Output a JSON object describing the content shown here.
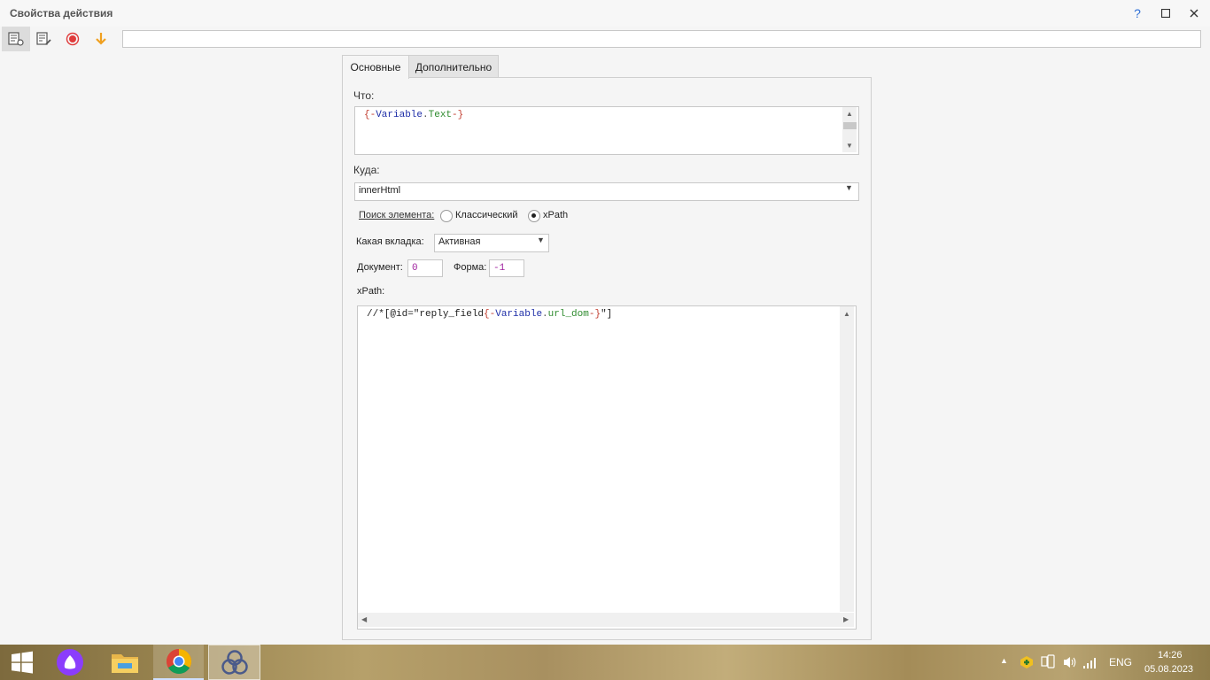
{
  "window": {
    "title": "Свойства действия"
  },
  "titlebar": {
    "help": "?",
    "maximize": "☐",
    "close": "✕"
  },
  "toolbar": {
    "icons": [
      "properties-icon",
      "edit-list-icon",
      "record-icon",
      "download-arrow-icon"
    ],
    "input_value": ""
  },
  "tabs": [
    {
      "label": "Основные",
      "active": true
    },
    {
      "label": "Дополнительно",
      "active": false
    }
  ],
  "form": {
    "what_label": "Что:",
    "what_value": {
      "open": "{-",
      "var": "Variable",
      "dot": ".",
      "name": "Text",
      "close": "-}"
    },
    "where_label": "Куда:",
    "where_value": "innerHtml",
    "search_label": "Поиск элемента:",
    "search_options": [
      "Классический",
      "xPath"
    ],
    "search_selected": "xPath",
    "which_tab_label": "Какая вкладка:",
    "which_tab_value": "Активная",
    "document_label": "Документ:",
    "document_value": "0",
    "form_label": "Форма:",
    "form_value": "-1",
    "xpath_label": "xPath:",
    "xpath_value": {
      "prefix": "//*[@id=\"reply_field",
      "open": "{-",
      "var": "Variable",
      "dot": ".",
      "name": "url_dom",
      "close": "-}",
      "suffix": "\"]"
    }
  },
  "colors": {
    "code_brace": "#c0392b",
    "code_var": "#1f2fa8",
    "code_name": "#2e8b2e",
    "record_red": "#e03a3a",
    "arrow_orange": "#f0a020"
  },
  "taskbar": {
    "apps": [
      "windows-start-icon",
      "alice-icon",
      "file-explorer-icon",
      "chrome-icon",
      "zennoposter-icon"
    ],
    "language": "ENG",
    "time": "14:26",
    "date": "05.08.2023"
  }
}
